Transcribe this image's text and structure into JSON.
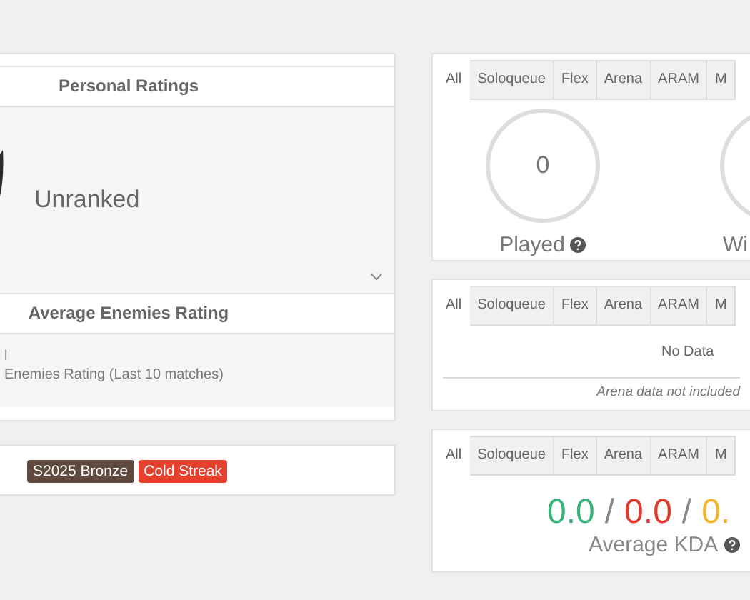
{
  "personal_ratings": {
    "title": "Personal Ratings",
    "rank": "Unranked",
    "expandable": true
  },
  "average_enemies_rating": {
    "title": "Average Enemies Rating",
    "lines": [
      "l",
      "Enemies Rating (Last 10 matches)"
    ]
  },
  "badges": [
    {
      "label": "S2025 Bronze",
      "color": "#5e4a3f"
    },
    {
      "label": "Cold Streak",
      "color": "#e5412d"
    }
  ],
  "stats_panel": {
    "tabs": [
      {
        "label": "All",
        "selected": true
      },
      {
        "label": "Soloqueue",
        "selected": false
      },
      {
        "label": "Flex",
        "selected": false
      },
      {
        "label": "Arena",
        "selected": false
      },
      {
        "label": "ARAM",
        "selected": false
      },
      {
        "label": "M",
        "selected": false
      }
    ],
    "circles": [
      {
        "value": "0",
        "label": "Played",
        "help": true
      },
      {
        "label": "Wi"
      }
    ]
  },
  "history_panel": {
    "tabs": [
      {
        "label": "All",
        "selected": true
      },
      {
        "label": "Soloqueue",
        "selected": false
      },
      {
        "label": "Flex",
        "selected": false
      },
      {
        "label": "Arena",
        "selected": false
      },
      {
        "label": "ARAM",
        "selected": false
      },
      {
        "label": "M",
        "selected": false
      }
    ],
    "message": "No Data",
    "note": "Arena data not included"
  },
  "kda_panel": {
    "tabs": [
      {
        "label": "All",
        "selected": true
      },
      {
        "label": "Soloqueue",
        "selected": false
      },
      {
        "label": "Flex",
        "selected": false
      },
      {
        "label": "Arena",
        "selected": false
      },
      {
        "label": "ARAM",
        "selected": false
      },
      {
        "label": "M",
        "selected": false
      }
    ],
    "kills": "0.0",
    "separator_1": "/",
    "deaths": "0.0",
    "separator_2": "/",
    "assists": "0.",
    "label": "Average KDA",
    "help": true
  }
}
